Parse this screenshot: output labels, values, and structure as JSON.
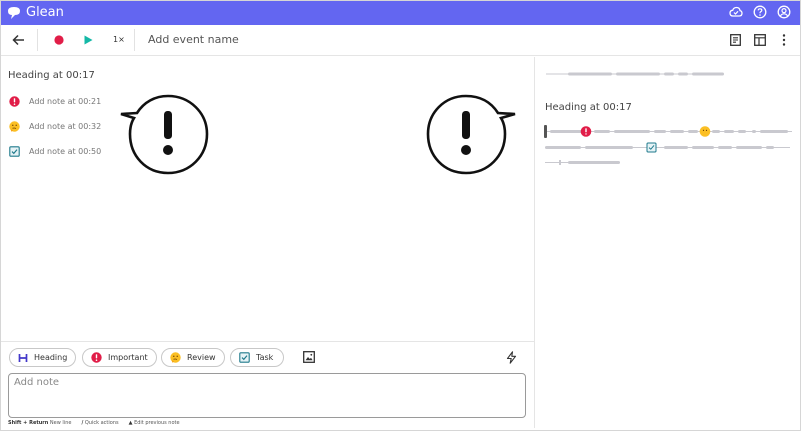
{
  "app": {
    "name": "Glean",
    "brand_color": "#6366f1",
    "header_icons": [
      "cloud-icon",
      "help-icon",
      "account-icon"
    ]
  },
  "toolbar": {
    "back_icon": "arrow-left-icon",
    "record_icon": "record-icon",
    "play_icon": "play-icon",
    "speed_label": "1×",
    "event_name_placeholder": "Add event name",
    "right_icons": [
      "notes-view-icon",
      "layout-icon",
      "more-vertical-icon"
    ]
  },
  "notes": {
    "heading": "Heading at 00:17",
    "items": [
      {
        "type": "important",
        "icon": "important-icon",
        "label": "Add note at 00:21"
      },
      {
        "type": "review",
        "icon": "thinking-face-icon",
        "label": "Add note at 00:32"
      },
      {
        "type": "task",
        "icon": "task-checkbox-icon",
        "label": "Add note at 00:50"
      }
    ]
  },
  "transcript": {
    "heading": "Heading at 00:17"
  },
  "note_types": [
    {
      "name": "heading",
      "icon": "heading-icon",
      "label": "Heading"
    },
    {
      "name": "important",
      "icon": "important-icon",
      "label": "Important"
    },
    {
      "name": "review",
      "icon": "thinking-face-icon",
      "label": "Review"
    },
    {
      "name": "task",
      "icon": "task-checkbox-icon",
      "label": "Task"
    }
  ],
  "editor": {
    "placeholder": "Add note",
    "image_icon": "image-icon",
    "quick_actions_icon": "lightning-icon",
    "hints": [
      {
        "key": "Shift + Return",
        "text": "New line"
      },
      {
        "key": "/",
        "text": "Quick actions"
      },
      {
        "key": "▲",
        "text": "Edit previous note"
      }
    ]
  },
  "colors": {
    "important": "#e11d48",
    "task": "#1f7a8c",
    "play": "#14b8a6"
  }
}
